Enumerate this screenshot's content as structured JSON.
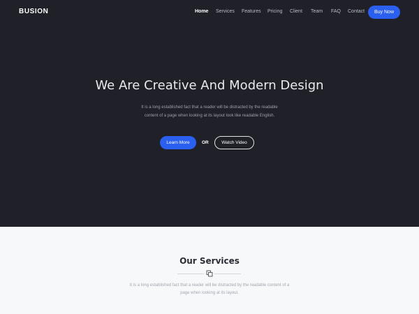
{
  "header": {
    "brand": "BUSION",
    "nav": [
      "Home",
      "Services",
      "Features",
      "Pricing",
      "Client",
      "Team",
      "FAQ",
      "Contact"
    ],
    "buy_label": "Buy Now"
  },
  "hero": {
    "title": "We Are Creative And Modern Design",
    "description": "It is a long established fact that a reader will be distracted by the readable content of a page when looking at its layout look like readable English.",
    "learn_label": "Learn More",
    "or_label": "OR",
    "watch_label": "Watch Video"
  },
  "services": {
    "title": "Our Services",
    "description": "It is a long established fact that a reader will be distracted by the readable content of a page when looking at its layout."
  },
  "colors": {
    "hero_bg": "#1f2028",
    "accent": "#2a5ff0",
    "section_bg": "#f7f8fa"
  }
}
